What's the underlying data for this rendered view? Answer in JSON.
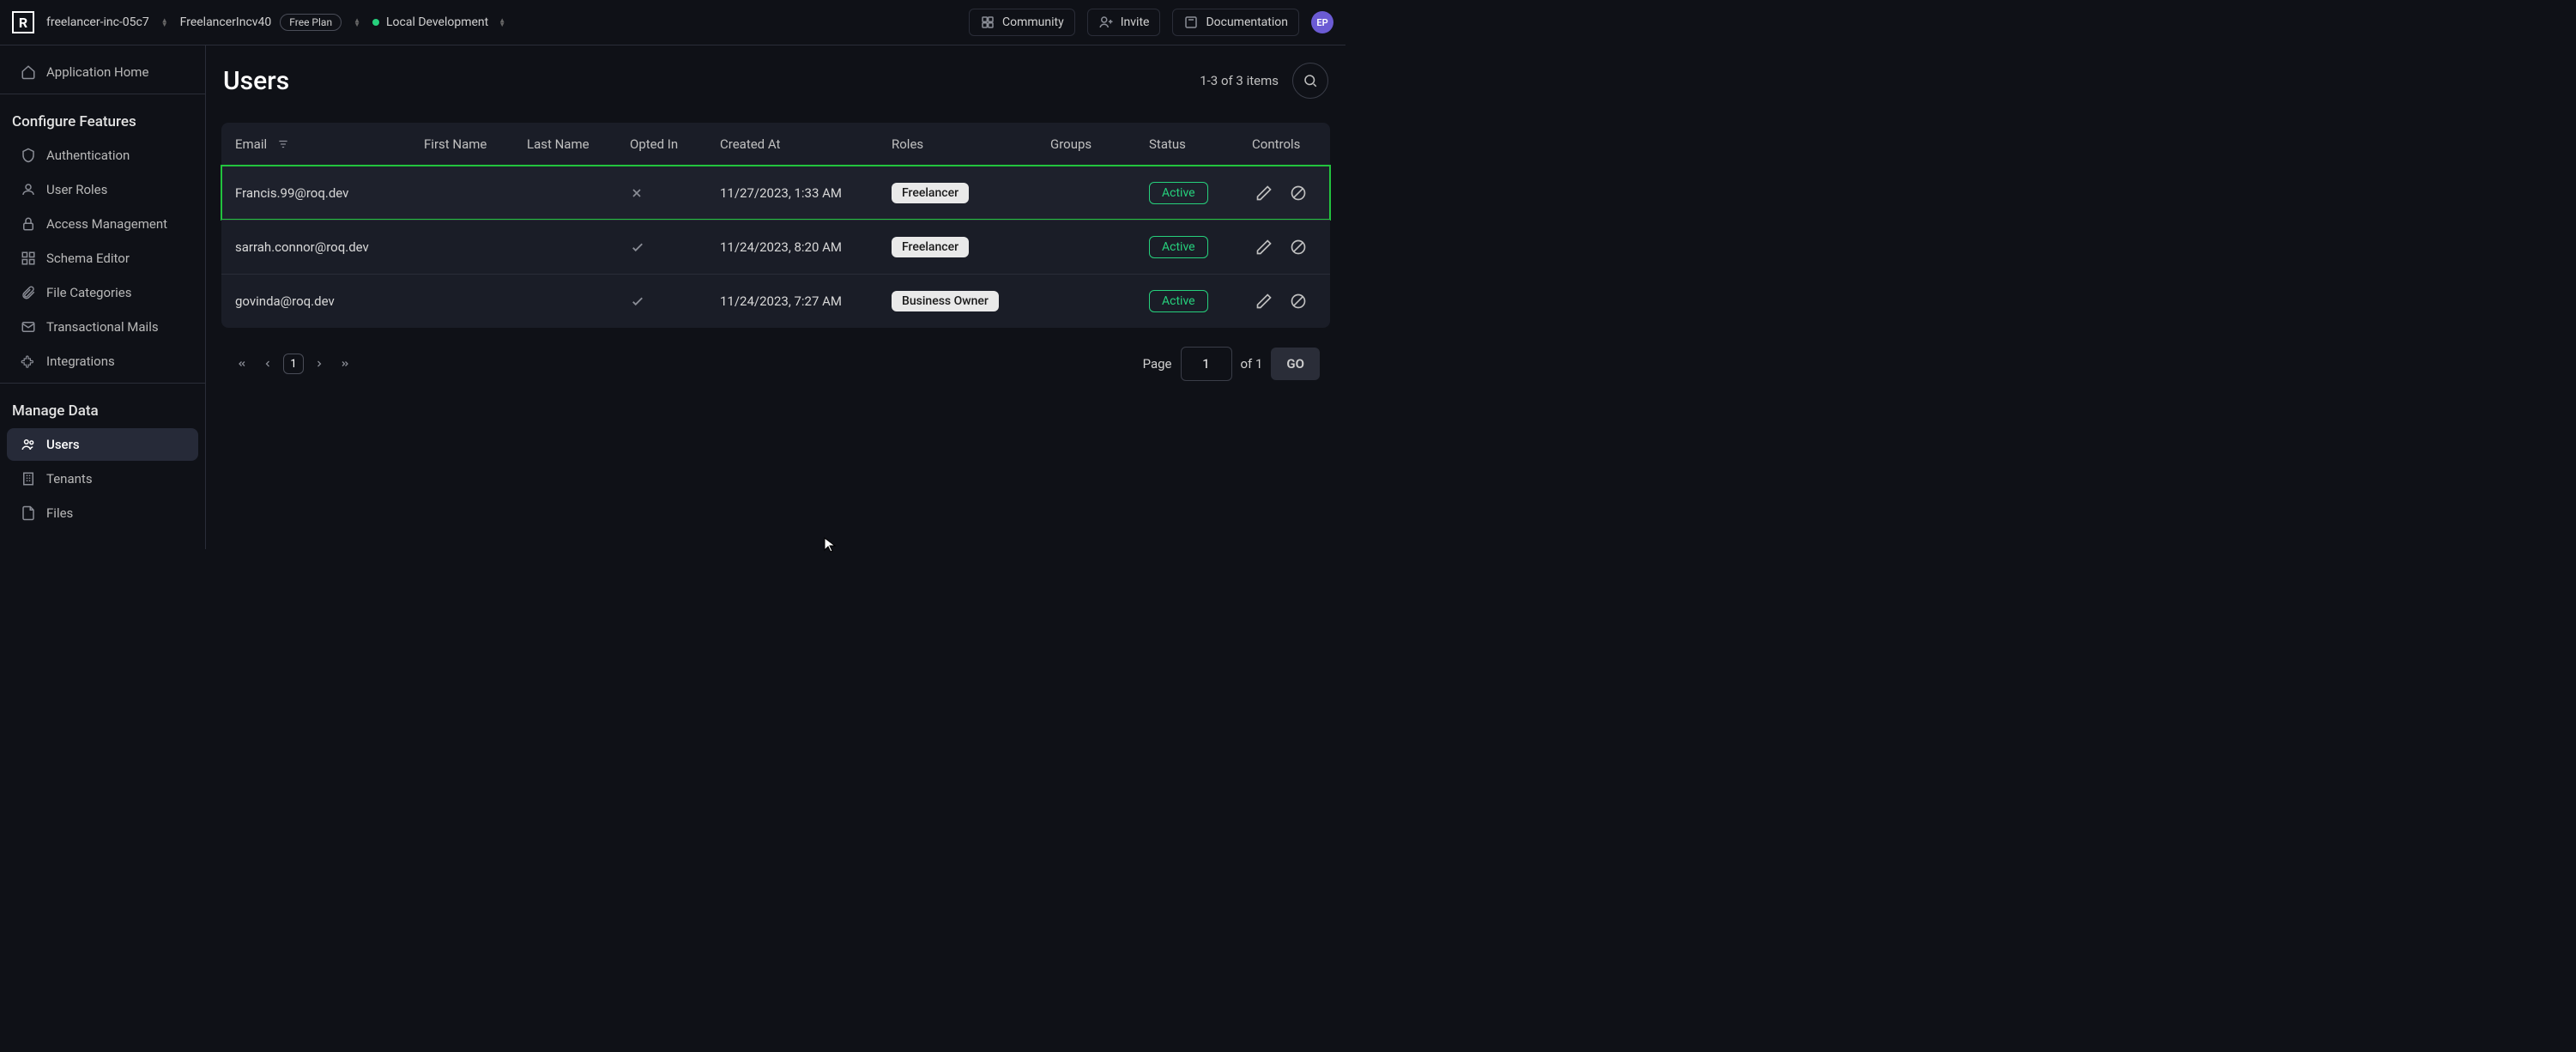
{
  "topbar": {
    "org": "freelancer-inc-05c7",
    "project": "FreelancerIncv40",
    "plan": "Free Plan",
    "env": "Local Development",
    "community": "Community",
    "invite": "Invite",
    "documentation": "Documentation",
    "avatar_initials": "EP"
  },
  "sidebar": {
    "home": "Application Home",
    "section_configure": "Configure Features",
    "authentication": "Authentication",
    "user_roles": "User Roles",
    "access_management": "Access Management",
    "schema_editor": "Schema Editor",
    "file_categories": "File Categories",
    "transactional_mails": "Transactional Mails",
    "integrations": "Integrations",
    "section_manage": "Manage Data",
    "users": "Users",
    "tenants": "Tenants",
    "files": "Files"
  },
  "page": {
    "title": "Users",
    "count": "1-3 of 3 items"
  },
  "columns": {
    "email": "Email",
    "first_name": "First Name",
    "last_name": "Last Name",
    "opted_in": "Opted In",
    "created_at": "Created At",
    "roles": "Roles",
    "groups": "Groups",
    "status": "Status",
    "controls": "Controls"
  },
  "rows": [
    {
      "email": "Francis.99@roq.dev",
      "opted": false,
      "created": "11/27/2023, 1:33 AM",
      "role": "Freelancer",
      "status": "Active",
      "highlight": true
    },
    {
      "email": "sarrah.connor@roq.dev",
      "opted": true,
      "created": "11/24/2023, 8:20 AM",
      "role": "Freelancer",
      "status": "Active",
      "highlight": false
    },
    {
      "email": "govinda@roq.dev",
      "opted": true,
      "created": "11/24/2023, 7:27 AM",
      "role": "Business Owner",
      "status": "Active",
      "highlight": false
    }
  ],
  "pagination": {
    "current": "1",
    "page_label": "Page",
    "page_value": "1",
    "of": "of 1",
    "go": "GO"
  }
}
